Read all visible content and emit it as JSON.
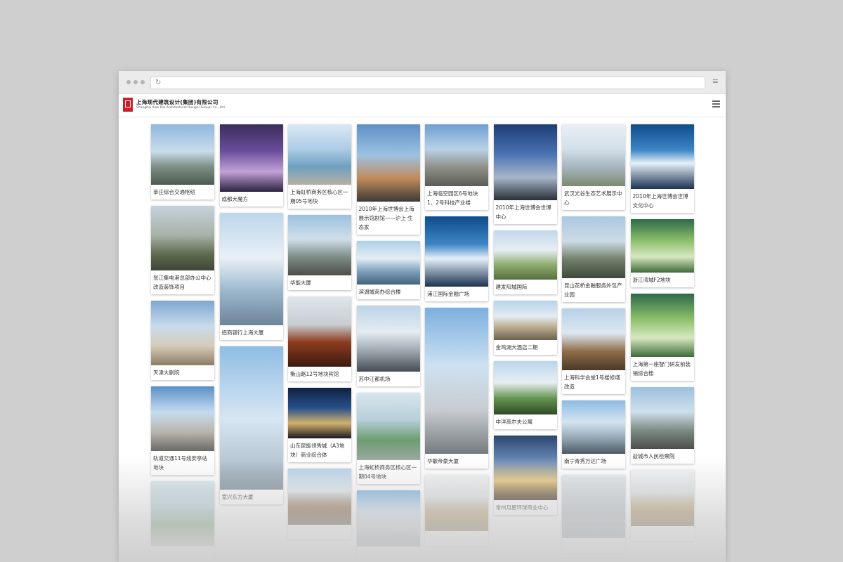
{
  "browser": {
    "reload_icon": "↻",
    "menu_icon": "≡"
  },
  "header": {
    "brand_cn": "上海现代建筑设计(集团)有限公司",
    "brand_en": "Shanghai Xian Dai Architectural Design (Group) Co., Ltd"
  },
  "columns": [
    {
      "cards": [
        {
          "caption": "莘庄综合交通枢纽",
          "img_h": 86,
          "cap_h": 21,
          "style": "ph1"
        },
        {
          "caption": "张江集电港总部办公中心改造装饰项目",
          "img_h": 92,
          "cap_h": 34,
          "style": "ph9"
        },
        {
          "caption": "天津大剧院",
          "img_h": 92,
          "cap_h": 21,
          "style": "ph13"
        },
        {
          "caption": "轨道交通11号线安亭站地块",
          "img_h": 92,
          "cap_h": 34,
          "style": "ph16"
        },
        {
          "caption": "",
          "img_h": 92,
          "cap_h": 21,
          "style": "ph21"
        }
      ]
    },
    {
      "cards": [
        {
          "caption": "成都大魔方",
          "img_h": 96,
          "cap_h": 21,
          "style": "ph2"
        },
        {
          "caption": "招商银行上海大厦",
          "img_h": 160,
          "cap_h": 21,
          "style": "ph10"
        },
        {
          "caption": "宽兴东方大厦",
          "img_h": 204,
          "cap_h": 21,
          "style": "ph17"
        }
      ]
    },
    {
      "cards": [
        {
          "caption": "上海虹桥商务区核心区一期05号地块",
          "img_h": 86,
          "cap_h": 34,
          "style": "ph3"
        },
        {
          "caption": "华能大厦",
          "img_h": 86,
          "cap_h": 21,
          "style": "ph11"
        },
        {
          "caption": "衡山路12号地块宾馆",
          "img_h": 100,
          "cap_h": 21,
          "style": "ph18"
        },
        {
          "caption": "山东昆能领秀城（A3地块）商业综合体",
          "img_h": 72,
          "cap_h": 34,
          "style": "ph20"
        },
        {
          "caption": "",
          "img_h": 80,
          "cap_h": 21,
          "style": "ph25"
        }
      ]
    },
    {
      "cards": [
        {
          "caption": "2010年上海世博会上海展示馆剧馆——沪上·生态家",
          "img_h": 110,
          "cap_h": 47,
          "style": "ph4"
        },
        {
          "caption": "滨湖城商办综合楼",
          "img_h": 62,
          "cap_h": 21,
          "style": "ph12"
        },
        {
          "caption": "苏中江都机场",
          "img_h": 94,
          "cap_h": 21,
          "style": "ph19"
        },
        {
          "caption": "上海虹桥商务区核心区一期04号地块",
          "img_h": 96,
          "cap_h": 34,
          "style": "ph21"
        },
        {
          "caption": "",
          "img_h": 80,
          "cap_h": 21,
          "style": "ph26"
        }
      ]
    },
    {
      "cards": [
        {
          "caption": "上海临空园区6号地块1、2号科技产业楼",
          "img_h": 88,
          "cap_h": 34,
          "style": "ph5"
        },
        {
          "caption": "浦江国际金融广场",
          "img_h": 100,
          "cap_h": 21,
          "style": "ph8"
        },
        {
          "caption": "华敏帝豪大厦",
          "img_h": 208,
          "cap_h": 21,
          "style": "ph26"
        },
        {
          "caption": "",
          "img_h": 80,
          "cap_h": 21,
          "style": "ph30"
        }
      ]
    },
    {
      "cards": [
        {
          "caption": "2010年上海世博会世博中心",
          "img_h": 108,
          "cap_h": 34,
          "style": "ph6"
        },
        {
          "caption": "建发阳城国际",
          "img_h": 70,
          "cap_h": 21,
          "style": "ph14"
        },
        {
          "caption": "金鸡湖大酒店二期",
          "img_h": 56,
          "cap_h": 21,
          "style": "ph22"
        },
        {
          "caption": "中洋高尔夫公寓",
          "img_h": 76,
          "cap_h": 21,
          "style": "ph23"
        },
        {
          "caption": "常州月星环球商业中心",
          "img_h": 92,
          "cap_h": 21,
          "style": "ph24"
        }
      ]
    },
    {
      "cards": [
        {
          "caption": "武汉光谷生态艺术展示中心",
          "img_h": 88,
          "cap_h": 34,
          "style": "ph7"
        },
        {
          "caption": "昆山花桥金融服务外包产业园",
          "img_h": 88,
          "cap_h": 34,
          "style": "ph15"
        },
        {
          "caption": "上海科学会堂1号楼修缮改造",
          "img_h": 88,
          "cap_h": 34,
          "style": "ph25"
        },
        {
          "caption": "南宁青秀万达广场",
          "img_h": 76,
          "cap_h": 21,
          "style": "ph29"
        },
        {
          "caption": "",
          "img_h": 90,
          "cap_h": 21,
          "style": "ph27"
        }
      ]
    },
    {
      "cards": [
        {
          "caption": "2010年上海世博会世博文化中心",
          "img_h": 92,
          "cap_h": 34,
          "style": "ph8"
        },
        {
          "caption": "浙江湾城F2地块",
          "img_h": 76,
          "cap_h": 21,
          "style": "ph28"
        },
        {
          "caption": "上海第一座智门研发前装销综合楼",
          "img_h": 90,
          "cap_h": 34,
          "style": "ph28"
        },
        {
          "caption": "盐城市人民检察院",
          "img_h": 88,
          "cap_h": 21,
          "style": "ph11"
        },
        {
          "caption": "",
          "img_h": 80,
          "cap_h": 21,
          "style": "ph30"
        }
      ]
    }
  ]
}
